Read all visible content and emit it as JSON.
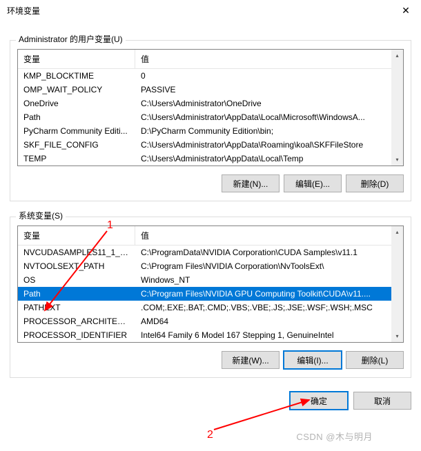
{
  "window": {
    "title": "环境变量",
    "close_glyph": "✕"
  },
  "user_section": {
    "title": "Administrator 的用户变量(U)",
    "header_var": "变量",
    "header_val": "值",
    "rows": [
      {
        "name": "KMP_BLOCKTIME",
        "value": "0"
      },
      {
        "name": "OMP_WAIT_POLICY",
        "value": "PASSIVE"
      },
      {
        "name": "OneDrive",
        "value": "C:\\Users\\Administrator\\OneDrive"
      },
      {
        "name": "Path",
        "value": "C:\\Users\\Administrator\\AppData\\Local\\Microsoft\\WindowsA..."
      },
      {
        "name": "PyCharm Community Editi...",
        "value": "D:\\PyCharm Community Edition\\bin;"
      },
      {
        "name": "SKF_FILE_CONFIG",
        "value": "C:\\Users\\Administrator\\AppData\\Roaming\\koal\\SKFFileStore"
      },
      {
        "name": "TEMP",
        "value": "C:\\Users\\Administrator\\AppData\\Local\\Temp"
      }
    ],
    "btn_new": "新建(N)...",
    "btn_edit": "编辑(E)...",
    "btn_delete": "删除(D)"
  },
  "sys_section": {
    "title": "系统变量(S)",
    "header_var": "变量",
    "header_val": "值",
    "rows": [
      {
        "name": "NVCUDASAMPLES11_1_R...",
        "value": "C:\\ProgramData\\NVIDIA Corporation\\CUDA Samples\\v11.1"
      },
      {
        "name": "NVTOOLSEXT_PATH",
        "value": "C:\\Program Files\\NVIDIA Corporation\\NvToolsExt\\"
      },
      {
        "name": "OS",
        "value": "Windows_NT"
      },
      {
        "name": "Path",
        "value": "C:\\Program Files\\NVIDIA GPU Computing Toolkit\\CUDA\\v11...."
      },
      {
        "name": "PATHEXT",
        "value": ".COM;.EXE;.BAT;.CMD;.VBS;.VBE;.JS;.JSE;.WSF;.WSH;.MSC"
      },
      {
        "name": "PROCESSOR_ARCHITECT...",
        "value": "AMD64"
      },
      {
        "name": "PROCESSOR_IDENTIFIER",
        "value": "Intel64 Family 6 Model 167 Stepping 1, GenuineIntel"
      }
    ],
    "selected_index": 3,
    "btn_new": "新建(W)...",
    "btn_edit": "编辑(I)...",
    "btn_delete": "删除(L)"
  },
  "footer": {
    "ok": "确定",
    "cancel": "取消"
  },
  "annotations": {
    "label1": "1",
    "label2": "2"
  },
  "watermark": "CSDN @木与明月"
}
